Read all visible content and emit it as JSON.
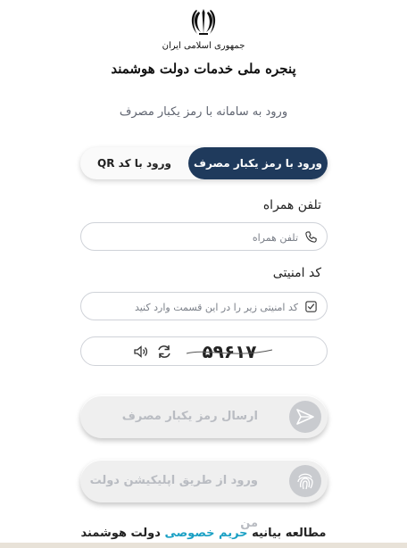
{
  "header": {
    "country": "جمهوری اسلامی ایران",
    "portal": "پنجره ملی خدمات دولت هوشمند"
  },
  "subtitle": "ورود به سامانه با رمز یکبار مصرف",
  "tabs": {
    "otp": "ورود با رمز یکبار مصرف",
    "qr": "ورود با کد QR"
  },
  "phone": {
    "label": "تلفن همراه",
    "placeholder": "تلفن همراه"
  },
  "security": {
    "label": "کد امنیتی",
    "placeholder": "کد امنیتی زیر را در این قسمت وارد کنید"
  },
  "captcha": {
    "code": "۵۹۶۱۷"
  },
  "buttons": {
    "send": "ارسال رمز یکبار مصرف",
    "app": "ورود از طریق اپلیکیشن دولت من"
  },
  "footer": {
    "prefix": "مطالعه بیانیه",
    "link": "حریم خصوصی",
    "suffix": "دولت هوشمند"
  }
}
